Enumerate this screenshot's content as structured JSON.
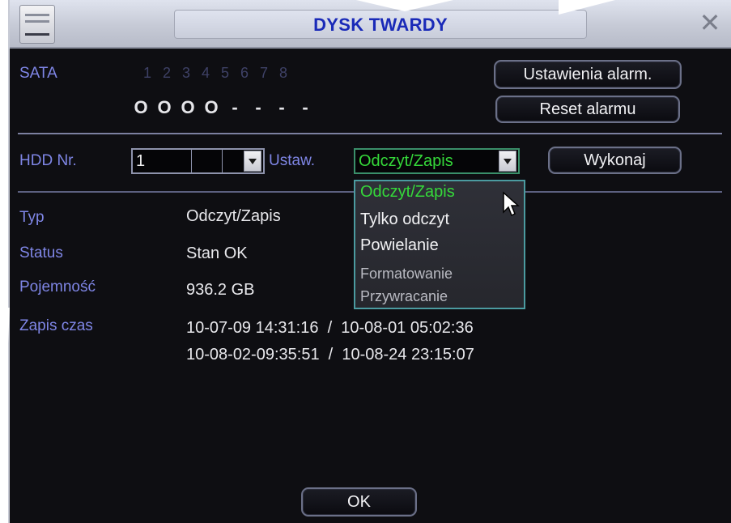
{
  "window": {
    "title": "DYSK TWARDY",
    "close_glyph": "✕"
  },
  "sata": {
    "label": "SATA",
    "ports": [
      "1",
      "2",
      "3",
      "4",
      "5",
      "6",
      "7",
      "8"
    ],
    "status": [
      "O",
      "O",
      "O",
      "O",
      "-",
      "-",
      "-",
      "-"
    ]
  },
  "buttons": {
    "alarm_settings": "Ustawienia alarm.",
    "reset_alarm": "Reset alarmu",
    "execute": "Wykonaj",
    "ok": "OK"
  },
  "hdd": {
    "label": "HDD Nr.",
    "selected": "1"
  },
  "set": {
    "label": "Ustaw.",
    "selected": "Odczyt/Zapis",
    "options": [
      "Odczyt/Zapis",
      "Tylko odczyt",
      "Powielanie",
      "Formatowanie",
      "Przywracanie"
    ]
  },
  "info": {
    "type_label": "Typ",
    "type_value": "Odczyt/Zapis",
    "status_label": "Status",
    "status_value": "Stan OK",
    "capacity_label": "Pojemność",
    "capacity_value": "936.2 GB",
    "rec_label": "Zapis czas",
    "rec_line1": "10-07-09 14:31:16  /  10-08-01 05:02:36",
    "rec_line2": "10-08-02-09:35:51  /  10-08-24 23:15:07"
  },
  "colors": {
    "title_text": "#1a2ab8",
    "label": "#7f86e6",
    "active_option": "#35d83a",
    "background": "#0e0e12"
  }
}
